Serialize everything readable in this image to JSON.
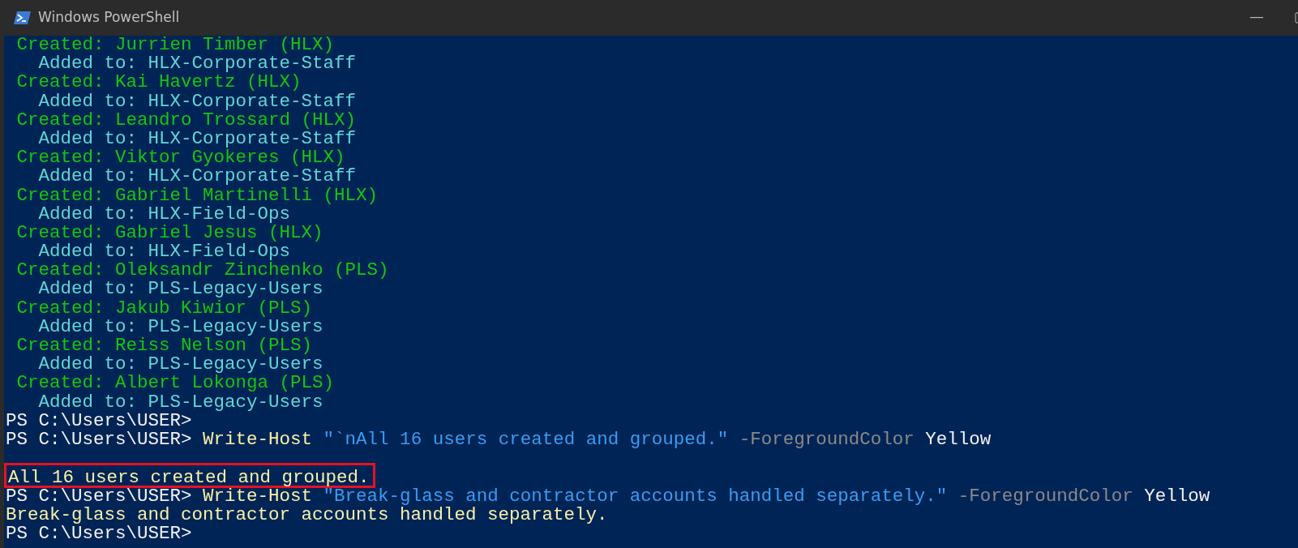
{
  "window": {
    "title": "Windows PowerShell"
  },
  "console": {
    "lines": [
      {
        "kind": "created",
        "text": "Created: Jurrien Timber (HLX)"
      },
      {
        "kind": "added",
        "text": "Added to: HLX-Corporate-Staff"
      },
      {
        "kind": "created",
        "text": "Created: Kai Havertz (HLX)"
      },
      {
        "kind": "added",
        "text": "Added to: HLX-Corporate-Staff"
      },
      {
        "kind": "created",
        "text": "Created: Leandro Trossard (HLX)"
      },
      {
        "kind": "added",
        "text": "Added to: HLX-Corporate-Staff"
      },
      {
        "kind": "created",
        "text": "Created: Viktor Gyokeres (HLX)"
      },
      {
        "kind": "added",
        "text": "Added to: HLX-Corporate-Staff"
      },
      {
        "kind": "created",
        "text": "Created: Gabriel Martinelli (HLX)"
      },
      {
        "kind": "added",
        "text": "Added to: HLX-Field-Ops"
      },
      {
        "kind": "created",
        "text": "Created: Gabriel Jesus (HLX)"
      },
      {
        "kind": "added",
        "text": "Added to: HLX-Field-Ops"
      },
      {
        "kind": "created",
        "text": "Created: Oleksandr Zinchenko (PLS)"
      },
      {
        "kind": "added",
        "text": "Added to: PLS-Legacy-Users"
      },
      {
        "kind": "created",
        "text": "Created: Jakub Kiwior (PLS)"
      },
      {
        "kind": "added",
        "text": "Added to: PLS-Legacy-Users"
      },
      {
        "kind": "created",
        "text": "Created: Reiss Nelson (PLS)"
      },
      {
        "kind": "added",
        "text": "Added to: PLS-Legacy-Users"
      },
      {
        "kind": "created",
        "text": "Created: Albert Lokonga (PLS)"
      },
      {
        "kind": "added",
        "text": "Added to: PLS-Legacy-Users"
      },
      {
        "kind": "prompt",
        "text": "PS C:\\Users\\USER>"
      },
      {
        "kind": "command",
        "prompt": "PS C:\\Users\\USER>",
        "cmdlet": "Write-Host",
        "string": "\"`nAll 16 users created and grouped.\"",
        "parameter": "-ForegroundColor",
        "value": "Yellow"
      },
      {
        "kind": "blank"
      },
      {
        "kind": "output",
        "text": "All 16 users created and grouped.",
        "highlighted": true
      },
      {
        "kind": "command",
        "prompt": "PS C:\\Users\\USER>",
        "cmdlet": "Write-Host",
        "string": "\"Break-glass and contractor accounts handled separately.\"",
        "parameter": "-ForegroundColor",
        "value": "Yellow"
      },
      {
        "kind": "output",
        "text": "Break-glass and contractor accounts handled separately.",
        "highlighted": false
      },
      {
        "kind": "prompt",
        "text": "PS C:\\Users\\USER>"
      }
    ]
  }
}
